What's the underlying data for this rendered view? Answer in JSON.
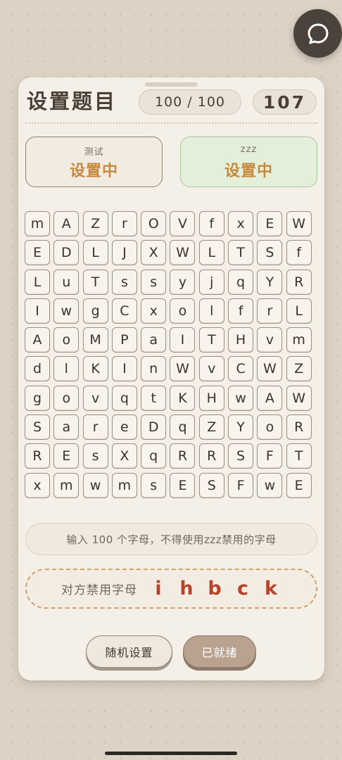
{
  "header": {
    "title": "设置题目",
    "progress": "100 / 100",
    "timer": "107"
  },
  "players": {
    "me": {
      "name": "测试",
      "status": "设置中"
    },
    "opponent": {
      "name": "zzz",
      "status": "设置中"
    }
  },
  "grid": {
    "rows": [
      [
        "m",
        "A",
        "Z",
        "r",
        "O",
        "V",
        "f",
        "x",
        "E",
        "W"
      ],
      [
        "E",
        "D",
        "L",
        "J",
        "X",
        "W",
        "L",
        "T",
        "S",
        "f"
      ],
      [
        "L",
        "u",
        "T",
        "s",
        "s",
        "y",
        "j",
        "q",
        "Y",
        "R"
      ],
      [
        "I",
        "w",
        "g",
        "C",
        "x",
        "o",
        "l",
        "f",
        "r",
        "L"
      ],
      [
        "A",
        "o",
        "M",
        "P",
        "a",
        "I",
        "T",
        "H",
        "v",
        "m"
      ],
      [
        "d",
        "l",
        "K",
        "I",
        "n",
        "W",
        "v",
        "C",
        "W",
        "Z"
      ],
      [
        "g",
        "o",
        "v",
        "q",
        "t",
        "K",
        "H",
        "w",
        "A",
        "W"
      ],
      [
        "S",
        "a",
        "r",
        "e",
        "D",
        "q",
        "Z",
        "Y",
        "o",
        "R"
      ],
      [
        "R",
        "E",
        "s",
        "X",
        "q",
        "R",
        "R",
        "S",
        "F",
        "T"
      ],
      [
        "x",
        "m",
        "w",
        "m",
        "s",
        "E",
        "S",
        "F",
        "w",
        "E"
      ]
    ]
  },
  "hint": "输入 100 个字母，不得使用zzz禁用的字母",
  "banned": {
    "label": "对方禁用字母",
    "letters": [
      "i",
      "h",
      "b",
      "c",
      "k"
    ]
  },
  "buttons": {
    "random": "随机设置",
    "ready": "已就绪"
  },
  "icons": {
    "chat": "chat-bubble-icon"
  },
  "colors": {
    "status_accent": "#c7893e",
    "banned_letter": "#b4452c",
    "opponent_card_bg": "#e3efd9"
  }
}
